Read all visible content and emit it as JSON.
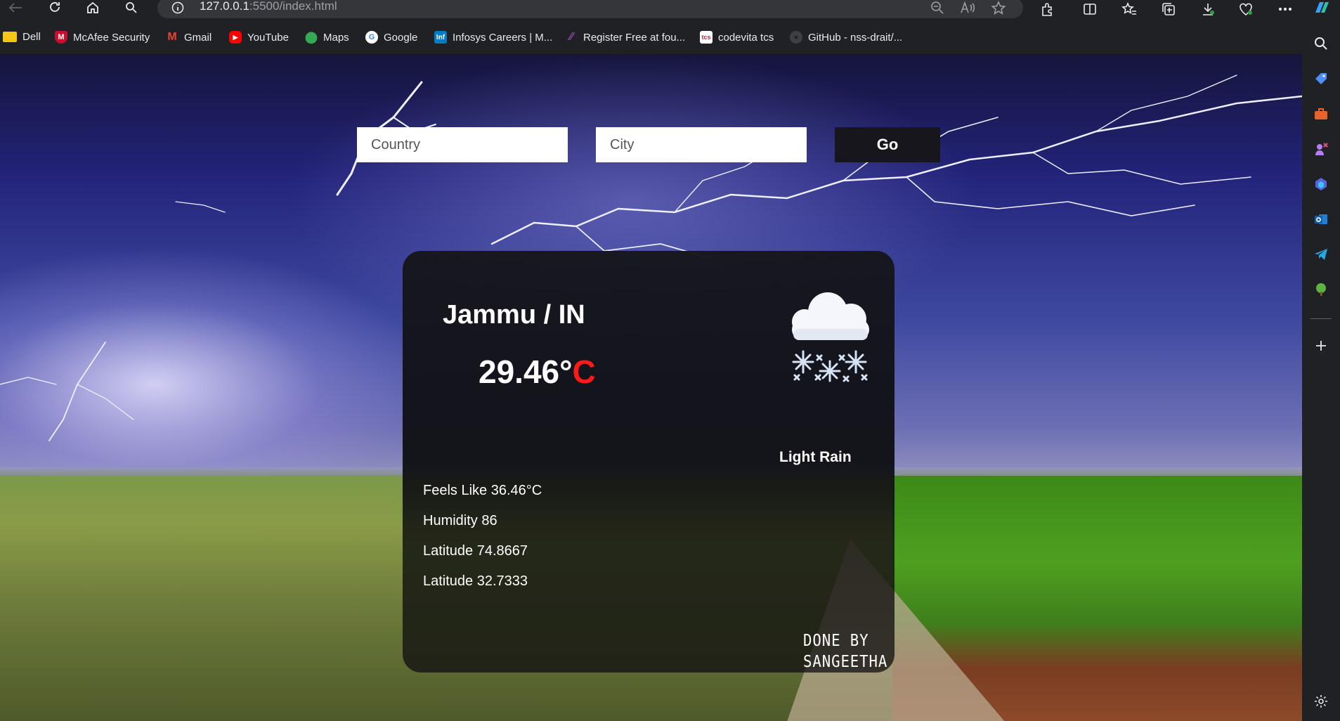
{
  "browser": {
    "url_host": "127.0.0.1",
    "url_rest": ":5500/index.html"
  },
  "bookmarks": [
    {
      "label": "Dell",
      "icon": "folder-icon",
      "color": "#f5c518"
    },
    {
      "label": "McAfee Security",
      "icon": "mcafee-icon",
      "color": "#c8102e"
    },
    {
      "label": "Gmail",
      "icon": "gmail-icon",
      "color": "#ea4335"
    },
    {
      "label": "YouTube",
      "icon": "youtube-icon",
      "color": "#ff0000"
    },
    {
      "label": "Maps",
      "icon": "maps-icon",
      "color": "#34a853"
    },
    {
      "label": "Google",
      "icon": "google-icon",
      "color": "#4285f4"
    },
    {
      "label": "Infosys Careers | M...",
      "icon": "infosys-icon",
      "color": "#007cc3"
    },
    {
      "label": "Register Free at fou...",
      "icon": "register-icon",
      "color": "#8e44ad"
    },
    {
      "label": "codevita tcs",
      "icon": "tcs-icon",
      "color": "#e31837"
    },
    {
      "label": "GitHub - nss-drait/...",
      "icon": "github-icon",
      "color": "#9aa0a6"
    }
  ],
  "form": {
    "country_placeholder": "Country",
    "city_placeholder": "City",
    "go_label": "Go"
  },
  "weather": {
    "location": "Jammu / IN",
    "temperature": "29.46°",
    "temperature_unit": "C",
    "description": "Light Rain",
    "icon": "snow-cloud-icon",
    "feels_like": "Feels Like 36.46°C",
    "humidity": "Humidity 86",
    "latitude_1": "Latitude 74.8667",
    "latitude_2": "Latitude 32.7333",
    "credit_line1": "DONE BY",
    "credit_line2": "SANGEETHA"
  },
  "colors": {
    "accent_unit": "#ff1a1a",
    "card_bg": "#16161c"
  }
}
